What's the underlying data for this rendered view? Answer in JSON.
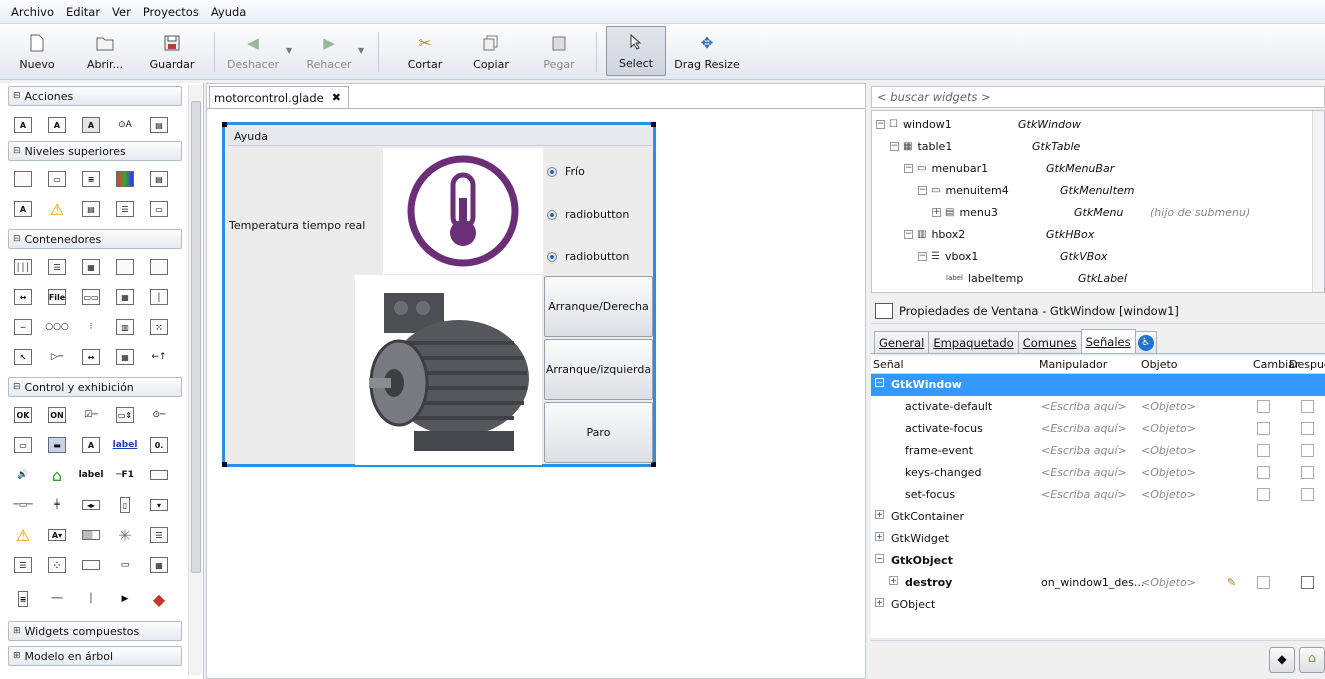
{
  "menubar": {
    "items": [
      "Archivo",
      "Editar",
      "Ver",
      "Proyectos",
      "Ayuda"
    ]
  },
  "toolbar": {
    "new": "Nuevo",
    "open": "Abrir...",
    "save": "Guardar",
    "undo": "Deshacer",
    "redo": "Rehacer",
    "cut": "Cortar",
    "copy": "Copiar",
    "paste": "Pegar",
    "select": "Select",
    "drag_resize": "Drag Resize"
  },
  "palette": {
    "groups": [
      "Acciones",
      "Niveles superiores",
      "Contenedores",
      "Control y exhibición",
      "Widgets compuestos",
      "Modelo en árbol"
    ]
  },
  "editor": {
    "tab": "motorcontrol.glade",
    "window_menu": "Ayuda",
    "temp_label": "Temperatura tiempo real",
    "radios": [
      "Frío",
      "radiobutton",
      "radiobutton"
    ],
    "buttons": [
      "Arranque/Derecha",
      "Arranque/izquierda",
      "Paro"
    ]
  },
  "inspector": {
    "search_placeholder": "< buscar widgets >",
    "tree": [
      {
        "name": "window1",
        "class": "GtkWindow",
        "extra": ""
      },
      {
        "name": "table1",
        "class": "GtkTable",
        "extra": ""
      },
      {
        "name": "menubar1",
        "class": "GtkMenuBar",
        "extra": ""
      },
      {
        "name": "menuitem4",
        "class": "GtkMenuItem",
        "extra": ""
      },
      {
        "name": "menu3",
        "class": "GtkMenu",
        "extra": "(hijo de submenu)"
      },
      {
        "name": "hbox2",
        "class": "GtkHBox",
        "extra": ""
      },
      {
        "name": "vbox1",
        "class": "GtkVBox",
        "extra": ""
      },
      {
        "name": "labeltemp",
        "class": "GtkLabel",
        "extra": ""
      }
    ]
  },
  "properties": {
    "title": "Propiedades de Ventana - GtkWindow [window1]",
    "tabs": [
      "General",
      "Empaquetado",
      "Comunes",
      "Señales"
    ],
    "columns": {
      "signal": "Señal",
      "handler": "Manipulador",
      "object": "Objeto",
      "swap": "Cambiar",
      "after": "Después"
    },
    "groups": {
      "window": "GtkWindow",
      "container": "GtkContainer",
      "widget": "GtkWidget",
      "object": "GtkObject",
      "gobject": "GObject"
    },
    "signals": [
      "activate-default",
      "activate-focus",
      "frame-event",
      "keys-changed",
      "set-focus"
    ],
    "placeholder_handler": "<Escriba aquí>",
    "placeholder_object": "<Objeto>",
    "destroy": {
      "name": "destroy",
      "handler": "on_window1_des...",
      "object": "<Objeto>"
    }
  },
  "colors": {
    "accent": "#2b8de6",
    "selection": "#3399ff",
    "thermo": "#6b2f78"
  }
}
